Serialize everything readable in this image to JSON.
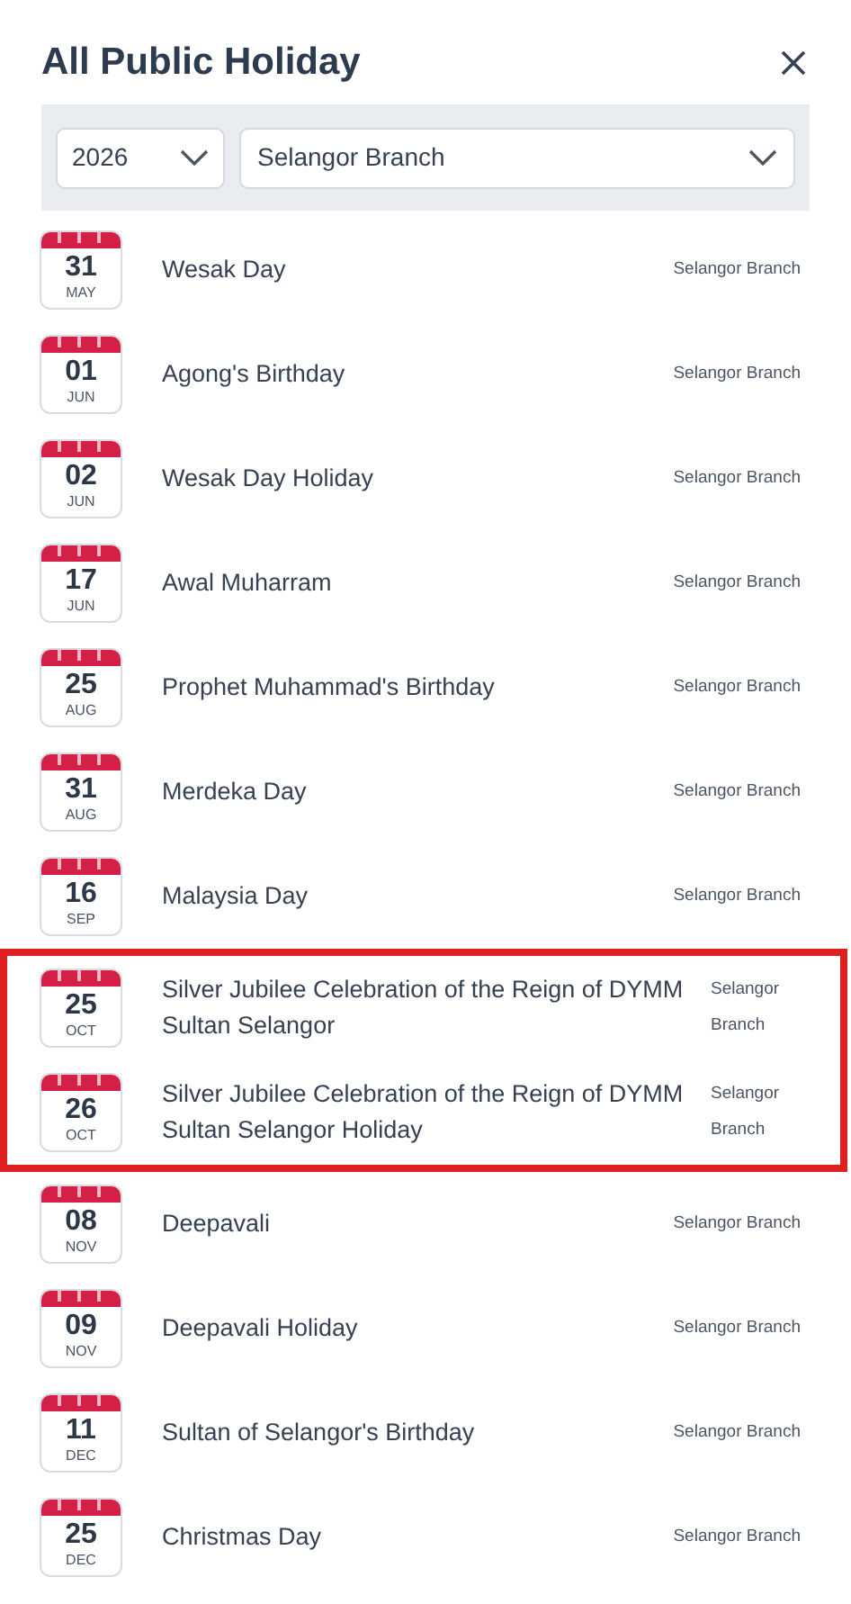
{
  "title": "All Public Holiday",
  "filters": {
    "year": "2026",
    "branch": "Selangor Branch"
  },
  "holidays": [
    {
      "day": "31",
      "month": "MAY",
      "name": "Wesak Day",
      "branch": "Selangor Branch",
      "highlighted": false
    },
    {
      "day": "01",
      "month": "JUN",
      "name": "Agong's Birthday",
      "branch": "Selangor Branch",
      "highlighted": false
    },
    {
      "day": "02",
      "month": "JUN",
      "name": "Wesak Day Holiday",
      "branch": "Selangor Branch",
      "highlighted": false
    },
    {
      "day": "17",
      "month": "JUN",
      "name": "Awal Muharram",
      "branch": "Selangor Branch",
      "highlighted": false
    },
    {
      "day": "25",
      "month": "AUG",
      "name": "Prophet Muhammad's Birthday",
      "branch": "Selangor Branch",
      "highlighted": false
    },
    {
      "day": "31",
      "month": "AUG",
      "name": "Merdeka Day",
      "branch": "Selangor Branch",
      "highlighted": false
    },
    {
      "day": "16",
      "month": "SEP",
      "name": "Malaysia Day",
      "branch": "Selangor Branch",
      "highlighted": false
    },
    {
      "day": "25",
      "month": "OCT",
      "name": "Silver Jubilee Celebration of the Reign of DYMM Sultan Selangor",
      "branch": "Selangor Branch",
      "highlighted": true
    },
    {
      "day": "26",
      "month": "OCT",
      "name": "Silver Jubilee Celebration of the Reign of DYMM Sultan Selangor Holiday",
      "branch": "Selangor Branch",
      "highlighted": true
    },
    {
      "day": "08",
      "month": "NOV",
      "name": "Deepavali",
      "branch": "Selangor Branch",
      "highlighted": false
    },
    {
      "day": "09",
      "month": "NOV",
      "name": "Deepavali Holiday",
      "branch": "Selangor Branch",
      "highlighted": false
    },
    {
      "day": "11",
      "month": "DEC",
      "name": "Sultan of Selangor's Birthday",
      "branch": "Selangor Branch",
      "highlighted": false
    },
    {
      "day": "25",
      "month": "DEC",
      "name": "Christmas Day",
      "branch": "Selangor Branch",
      "highlighted": false
    }
  ]
}
